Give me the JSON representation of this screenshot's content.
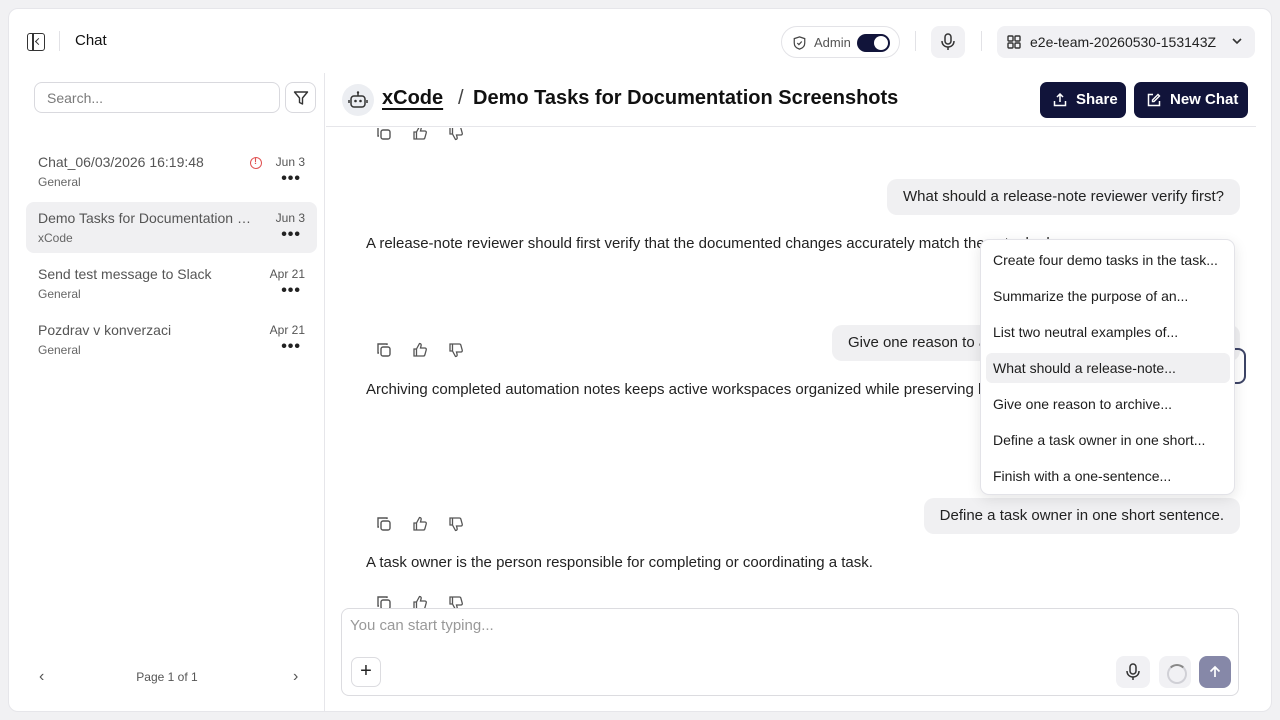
{
  "app": {
    "title": "Chat"
  },
  "topbar": {
    "admin_label": "Admin",
    "admin_enabled": true,
    "team_name": "e2e-team-20260530-153143Z"
  },
  "sidebar": {
    "search_placeholder": "Search...",
    "chats": [
      {
        "name": "Chat_06/03/2026 16:19:48",
        "workspace": "General",
        "date": "Jun 3",
        "has_error": true,
        "active": false
      },
      {
        "name": "Demo Tasks for Documentation Screenshots",
        "workspace": "xCode",
        "date": "Jun 3",
        "has_error": false,
        "active": true
      },
      {
        "name": "Send test message to Slack",
        "workspace": "General",
        "date": "Apr 21",
        "has_error": false,
        "active": false
      },
      {
        "name": "Pozdrav v konverzaci",
        "workspace": "General",
        "date": "Apr 21",
        "has_error": false,
        "active": false
      }
    ],
    "more_label": "•••",
    "pagination": {
      "label": "Page 1 of 1",
      "prev": "‹",
      "next": "›"
    }
  },
  "header": {
    "project": "xCode",
    "separator": "/",
    "chat_title": "Demo Tasks for Documentation Screenshots",
    "share_label": "Share",
    "new_chat_label": "New Chat"
  },
  "conversation": {
    "messages": [
      {
        "role": "user",
        "text": "What should a release-note reviewer verify first?"
      },
      {
        "role": "assistant",
        "text": "A release-note reviewer should first verify that the documented changes accurately match the actual release scope."
      },
      {
        "role": "user",
        "text": "Give one reason to archive completed automation notes."
      },
      {
        "role": "assistant",
        "text": "Archiving completed automation notes keeps active workspaces organized while preserving history for future reference."
      },
      {
        "role": "user",
        "text": "Define a task owner in one short sentence."
      },
      {
        "role": "assistant",
        "text": "A task owner is the person responsible for completing or coordinating a task."
      }
    ]
  },
  "prompt_menu": {
    "items": [
      "Create four demo tasks in the task...",
      "Summarize the purpose of an...",
      "List two neutral examples of...",
      "What should a release-note...",
      "Give one reason to archive...",
      "Define a task owner in one short...",
      "Finish with a one-sentence..."
    ],
    "highlighted_index": 3
  },
  "composer": {
    "placeholder": "You can start typing...",
    "add_label": "+"
  },
  "colors": {
    "primary": "#11143a",
    "send_disabled": "#8688a8",
    "error": "#e05252"
  }
}
